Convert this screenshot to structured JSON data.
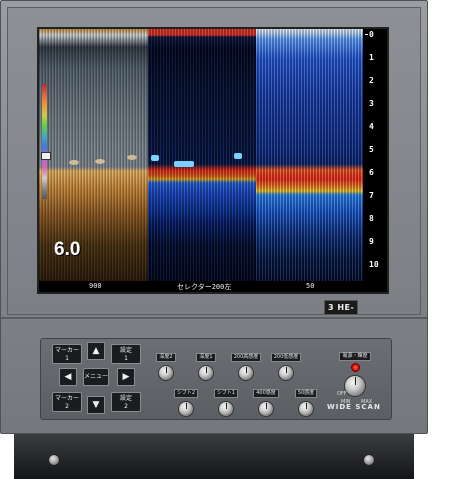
{
  "screen": {
    "panel1": {
      "value": "6.0",
      "bottom_label": "900"
    },
    "panel2": {
      "bottom_label": "セレクター200左"
    },
    "panel3": {
      "bottom_label": "50"
    },
    "depth_ticks": [
      "0",
      "1",
      "2",
      "3",
      "4",
      "5",
      "6",
      "7",
      "8",
      "9",
      "10"
    ]
  },
  "brand": "WIDE SCAN",
  "badge": "3 HE-",
  "controls": {
    "keys": {
      "marker1": [
        "マーカー",
        "1"
      ],
      "marker2": [
        "マーカー",
        "2"
      ],
      "setting1": [
        "設定",
        "1"
      ],
      "setting2": [
        "設定",
        "2"
      ],
      "menu": "メニュー"
    },
    "arrows": {
      "up": "▲",
      "down": "▼",
      "left": "◀",
      "right": "▶"
    },
    "knobs_top": [
      "深度2",
      "深度1",
      "200高感度",
      "200低感度"
    ],
    "knobs_bottom": [
      "シフト2",
      "シフト1",
      "400感度",
      "50感度"
    ],
    "power": "電源・輝度",
    "power_marks": {
      "off": "OFF",
      "min": "MIN",
      "max": "MAX"
    }
  }
}
